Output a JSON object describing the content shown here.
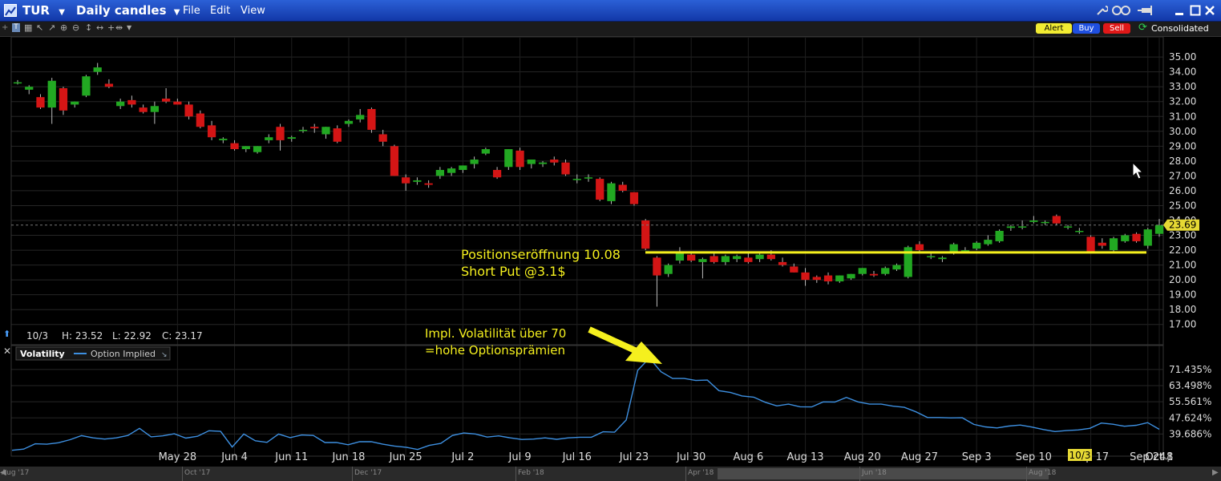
{
  "window": {
    "symbol": "TUR",
    "chart_type": "Daily candles",
    "menus": [
      "File",
      "Edit",
      "View"
    ]
  },
  "toolbar": {
    "alert_label": "Alert",
    "buy_label": "Buy",
    "sell_label": "Sell",
    "feed_label": "Consolidated"
  },
  "colors": {
    "up": "#22a822",
    "down": "#d41515",
    "annotation": "#f5f01e",
    "vol_line": "#3d8fe0"
  },
  "price_panel": {
    "info": {
      "date": "10/3",
      "high": "H: 23.52",
      "low": "L: 22.92",
      "close": "C: 23.17"
    },
    "last_price": "23.69",
    "annotation_line1": "Positionseröffnung 10.08",
    "annotation_line2": "Short Put  @3.1$"
  },
  "volatility_panel": {
    "title": "Volatility",
    "legend": "Option Implied",
    "annotation_line1": "Impl. Volatilität über 70",
    "annotation_line2": "=hohe Optionsprämien"
  },
  "x_axis": {
    "labels": [
      "May 28",
      "Jun 4",
      "Jun 11",
      "Jun 18",
      "Jun 25",
      "Jul 2",
      "Jul 9",
      "Jul 16",
      "Jul 23",
      "Jul 30",
      "Aug 6",
      "Aug 13",
      "Aug 20",
      "Aug 27",
      "Sep 3",
      "Sep 10",
      "Sep 17",
      "Sep 24",
      "Oct 1",
      "Oct 8"
    ],
    "current_date_tag": "10/3"
  },
  "timeline": {
    "labels": [
      "Aug '17",
      "Oct '17",
      "Dec '17",
      "Feb '18",
      "Apr '18",
      "Jun '18",
      "Aug '18"
    ]
  },
  "chart_data": [
    {
      "type": "candlestick",
      "ylim": [
        16.5,
        35.6
      ],
      "yticks": [
        "17.00",
        "18.00",
        "19.00",
        "20.00",
        "21.00",
        "22.00",
        "23.00",
        "24.00",
        "25.00",
        "26.00",
        "27.00",
        "28.00",
        "29.00",
        "30.00",
        "31.00",
        "32.00",
        "33.00",
        "34.00",
        "35.00"
      ],
      "hline": 21.85,
      "ohlc": [
        [
          33.3,
          33.45,
          33.15,
          33.3
        ],
        [
          32.8,
          33.1,
          32.5,
          33.0
        ],
        [
          32.3,
          32.5,
          31.5,
          31.6
        ],
        [
          31.6,
          33.6,
          30.5,
          33.4
        ],
        [
          32.9,
          33.0,
          31.1,
          31.4
        ],
        [
          31.8,
          32.0,
          31.6,
          32.0
        ],
        [
          32.4,
          33.8,
          32.3,
          33.7
        ],
        [
          34.0,
          34.6,
          33.8,
          34.3
        ],
        [
          33.2,
          33.5,
          32.9,
          33.0
        ],
        [
          31.7,
          32.2,
          31.5,
          32.0
        ],
        [
          32.1,
          32.4,
          31.6,
          31.8
        ],
        [
          31.6,
          31.8,
          31.2,
          31.3
        ],
        [
          31.3,
          32.0,
          30.5,
          31.7
        ],
        [
          32.2,
          32.9,
          31.9,
          32.0
        ],
        [
          32.0,
          32.2,
          31.8,
          31.8
        ],
        [
          31.8,
          32.0,
          30.8,
          31.0
        ],
        [
          31.2,
          31.4,
          30.2,
          30.3
        ],
        [
          30.4,
          30.7,
          29.4,
          29.6
        ],
        [
          29.4,
          29.6,
          29.2,
          29.5
        ],
        [
          29.2,
          29.4,
          28.7,
          28.8
        ],
        [
          28.8,
          29.0,
          28.6,
          29.0
        ],
        [
          28.6,
          29.0,
          28.5,
          29.0
        ],
        [
          29.4,
          29.8,
          29.2,
          29.6
        ],
        [
          30.3,
          30.5,
          28.7,
          29.4
        ],
        [
          29.5,
          29.7,
          29.3,
          29.6
        ],
        [
          30.1,
          30.3,
          29.9,
          30.1
        ],
        [
          30.3,
          30.5,
          29.9,
          30.2
        ],
        [
          29.8,
          30.3,
          29.5,
          30.3
        ],
        [
          30.2,
          30.4,
          29.2,
          29.3
        ],
        [
          30.5,
          30.8,
          30.3,
          30.7
        ],
        [
          30.8,
          31.5,
          30.6,
          31.1
        ],
        [
          31.5,
          31.6,
          29.9,
          30.1
        ],
        [
          29.8,
          30.1,
          29.0,
          29.3
        ],
        [
          29.0,
          29.1,
          27.0,
          27.0
        ],
        [
          26.9,
          27.1,
          26.0,
          26.5
        ],
        [
          26.6,
          26.9,
          26.4,
          26.7
        ],
        [
          26.5,
          26.7,
          26.2,
          26.4
        ],
        [
          27.0,
          27.6,
          26.8,
          27.4
        ],
        [
          27.2,
          27.6,
          27.0,
          27.5
        ],
        [
          27.4,
          27.7,
          27.2,
          27.7
        ],
        [
          27.8,
          28.3,
          27.5,
          28.1
        ],
        [
          28.5,
          28.9,
          28.4,
          28.8
        ],
        [
          27.4,
          27.6,
          26.8,
          26.9
        ],
        [
          27.6,
          28.8,
          27.4,
          28.8
        ],
        [
          28.7,
          28.9,
          27.4,
          27.6
        ],
        [
          27.8,
          28.1,
          27.5,
          28.1
        ],
        [
          27.8,
          28.0,
          27.6,
          27.9
        ],
        [
          28.1,
          28.3,
          27.7,
          27.9
        ],
        [
          27.9,
          28.1,
          27.0,
          27.1
        ],
        [
          26.8,
          27.1,
          26.5,
          26.8
        ],
        [
          26.9,
          27.1,
          26.6,
          26.9
        ],
        [
          26.8,
          26.9,
          25.3,
          25.4
        ],
        [
          25.3,
          26.6,
          25.1,
          26.5
        ],
        [
          26.4,
          26.6,
          25.9,
          26.0
        ],
        [
          25.9,
          25.9,
          25.0,
          25.1
        ],
        [
          24.0,
          24.1,
          22.0,
          22.1
        ],
        [
          21.5,
          21.6,
          18.2,
          20.3
        ],
        [
          20.4,
          21.1,
          20.2,
          21.0
        ],
        [
          21.3,
          22.2,
          21.1,
          21.8
        ],
        [
          21.7,
          21.9,
          21.2,
          21.3
        ],
        [
          21.2,
          21.5,
          20.1,
          21.4
        ],
        [
          21.6,
          21.8,
          21.1,
          21.2
        ],
        [
          21.2,
          21.7,
          21.0,
          21.6
        ],
        [
          21.4,
          21.7,
          21.2,
          21.6
        ],
        [
          21.5,
          21.8,
          21.1,
          21.2
        ],
        [
          21.4,
          21.9,
          21.2,
          21.7
        ],
        [
          21.7,
          22.0,
          21.3,
          21.4
        ],
        [
          21.2,
          21.5,
          20.9,
          21.0
        ],
        [
          20.9,
          21.1,
          20.5,
          20.5
        ],
        [
          20.5,
          20.8,
          19.6,
          20.0
        ],
        [
          20.2,
          20.3,
          19.8,
          20.0
        ],
        [
          20.3,
          20.5,
          19.7,
          19.9
        ],
        [
          19.9,
          20.3,
          19.8,
          20.3
        ],
        [
          20.1,
          20.4,
          20.0,
          20.4
        ],
        [
          20.4,
          20.8,
          20.3,
          20.8
        ],
        [
          20.4,
          20.6,
          20.2,
          20.3
        ],
        [
          20.4,
          20.9,
          20.3,
          20.8
        ],
        [
          20.7,
          21.1,
          20.6,
          21.0
        ],
        [
          20.2,
          22.3,
          20.1,
          22.2
        ],
        [
          22.4,
          22.6,
          21.9,
          22.0
        ],
        [
          21.6,
          21.8,
          21.4,
          21.6
        ],
        [
          21.4,
          21.6,
          21.2,
          21.5
        ],
        [
          21.8,
          22.5,
          21.7,
          22.4
        ],
        [
          22.0,
          22.2,
          21.9,
          22.0
        ],
        [
          22.1,
          22.6,
          22.0,
          22.5
        ],
        [
          22.4,
          23.0,
          22.3,
          22.7
        ],
        [
          22.6,
          23.4,
          22.5,
          23.3
        ],
        [
          23.5,
          23.7,
          23.3,
          23.6
        ],
        [
          23.6,
          24.0,
          23.4,
          23.6
        ],
        [
          23.9,
          24.3,
          23.8,
          24.0
        ],
        [
          23.9,
          24.0,
          23.7,
          23.9
        ],
        [
          24.3,
          24.4,
          23.7,
          23.8
        ],
        [
          23.6,
          23.7,
          23.4,
          23.6
        ],
        [
          23.3,
          23.5,
          23.1,
          23.3
        ],
        [
          22.9,
          23.0,
          21.8,
          21.9
        ],
        [
          22.5,
          22.8,
          22.1,
          22.3
        ],
        [
          22.0,
          22.9,
          21.9,
          22.8
        ],
        [
          22.6,
          23.1,
          22.5,
          23.0
        ],
        [
          23.1,
          23.2,
          22.5,
          22.6
        ],
        [
          22.3,
          23.5,
          22.1,
          23.4
        ],
        [
          23.1,
          24.1,
          22.9,
          23.69
        ]
      ]
    },
    {
      "type": "line",
      "name": "Option Implied",
      "ylim": [
        30.0,
        82.0
      ],
      "yticks": [
        "39.686%",
        "47.624%",
        "55.561%",
        "63.498%",
        "71.435%"
      ],
      "values": [
        31.7,
        32.3,
        34.9,
        34.7,
        35.4,
        36.9,
        38.9,
        37.8,
        37.2,
        37.8,
        39.0,
        42.5,
        38.3,
        38.8,
        39.8,
        37.7,
        38.6,
        41.3,
        41.0,
        33.3,
        39.7,
        36.4,
        35.6,
        39.7,
        37.9,
        39.2,
        39.0,
        35.5,
        35.5,
        34.4,
        35.9,
        35.9,
        34.7,
        33.8,
        33.2,
        32.1,
        34.1,
        35.1,
        39.0,
        40.2,
        39.7,
        38.2,
        38.8,
        37.8,
        37.0,
        37.2,
        37.8,
        37.1,
        37.8,
        38.1,
        38.1,
        40.8,
        40.6,
        46.6,
        71.0,
        77.0,
        70.3,
        67.0,
        67.0,
        66.0,
        66.2,
        61.0,
        60.1,
        58.4,
        57.8,
        55.3,
        53.5,
        54.4,
        53.1,
        53.0,
        55.5,
        55.4,
        57.7,
        55.5,
        54.4,
        54.4,
        53.4,
        52.8,
        50.6,
        47.8,
        47.8,
        47.6,
        47.7,
        44.4,
        43.2,
        42.7,
        43.6,
        44.1,
        43.1,
        41.9,
        40.9,
        41.4,
        41.7,
        42.5,
        45.1,
        44.5,
        43.5,
        44.0,
        45.3,
        42.0
      ]
    }
  ]
}
